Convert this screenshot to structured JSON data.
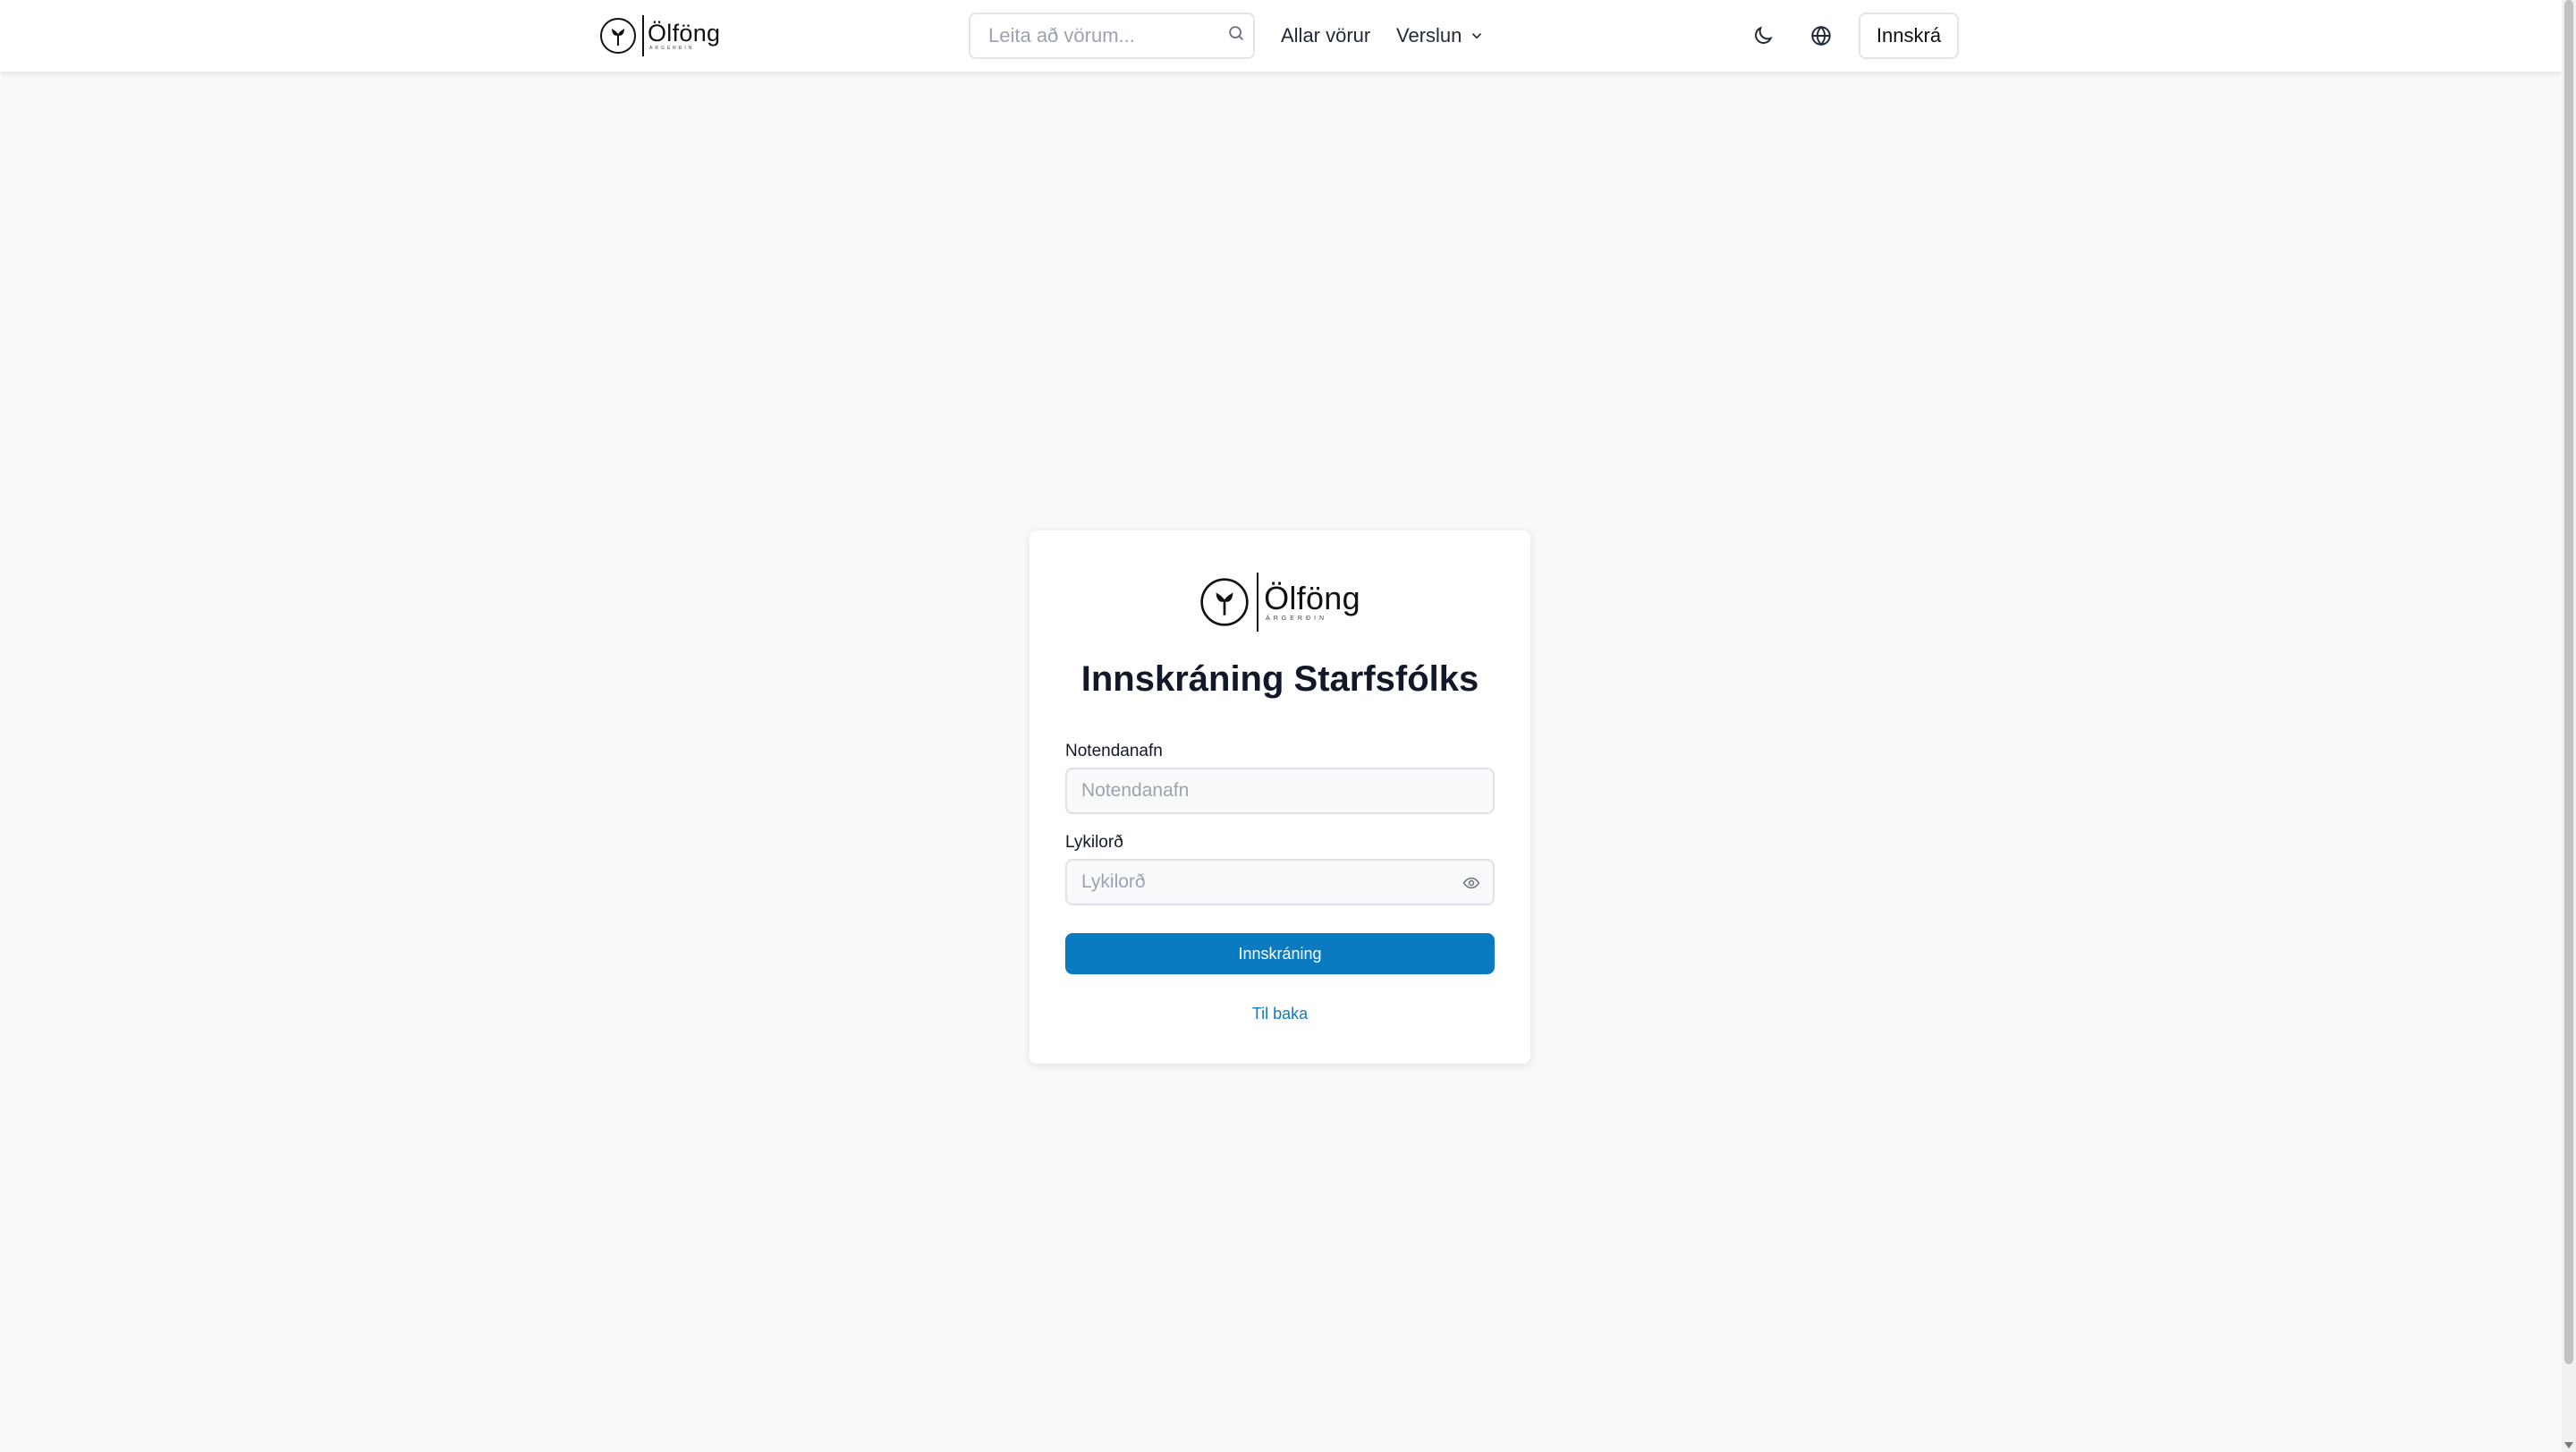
{
  "header": {
    "brand": {
      "name": "Ölföng",
      "tagline": "ÁRGERÐIN"
    },
    "search": {
      "placeholder": "Leita að vörum..."
    },
    "nav": {
      "all_products": "Allar vörur",
      "store": "Verslun"
    },
    "login_label": "Innskrá"
  },
  "card": {
    "brand": {
      "name": "Ölföng",
      "tagline": "ÁRGERÐIN"
    },
    "title": "Innskráning Starfsfólks",
    "username_label": "Notendanafn",
    "username_placeholder": "Notendanafn",
    "password_label": "Lykilorð",
    "password_placeholder": "Lykilorð",
    "submit_label": "Innskráning",
    "back_label": "Til baka"
  },
  "colors": {
    "accent": "#0b7bc1",
    "background": "#f8f9fa",
    "card": "#ffffff"
  },
  "icons": [
    "brand-logo-icon",
    "search-icon",
    "chevron-down-icon",
    "moon-icon",
    "globe-icon",
    "eye-icon"
  ]
}
